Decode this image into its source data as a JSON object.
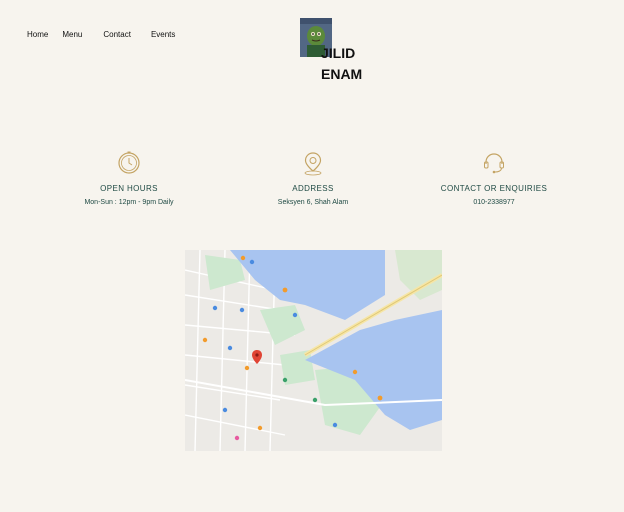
{
  "nav": {
    "items": [
      "Home",
      "Menu",
      "Contact",
      "Events"
    ]
  },
  "logo": {
    "line1": "JILID",
    "line2": "ENAM"
  },
  "info": [
    {
      "icon": "clock-icon",
      "heading": "OPEN HOURS",
      "value": "Mon-Sun : 12pm - 9pm Daily"
    },
    {
      "icon": "location-pin-icon",
      "heading": "ADDRESS",
      "value": "Seksyen 6, Shah Alam"
    },
    {
      "icon": "headset-icon",
      "heading": "CONTACT OR ENQUIRIES",
      "value": "010-2338977"
    }
  ],
  "colors": {
    "background": "#f7f4ee",
    "accent_icon": "#c4a464",
    "text_dark": "#1f4a44",
    "map_water": "#a8c4f0"
  }
}
